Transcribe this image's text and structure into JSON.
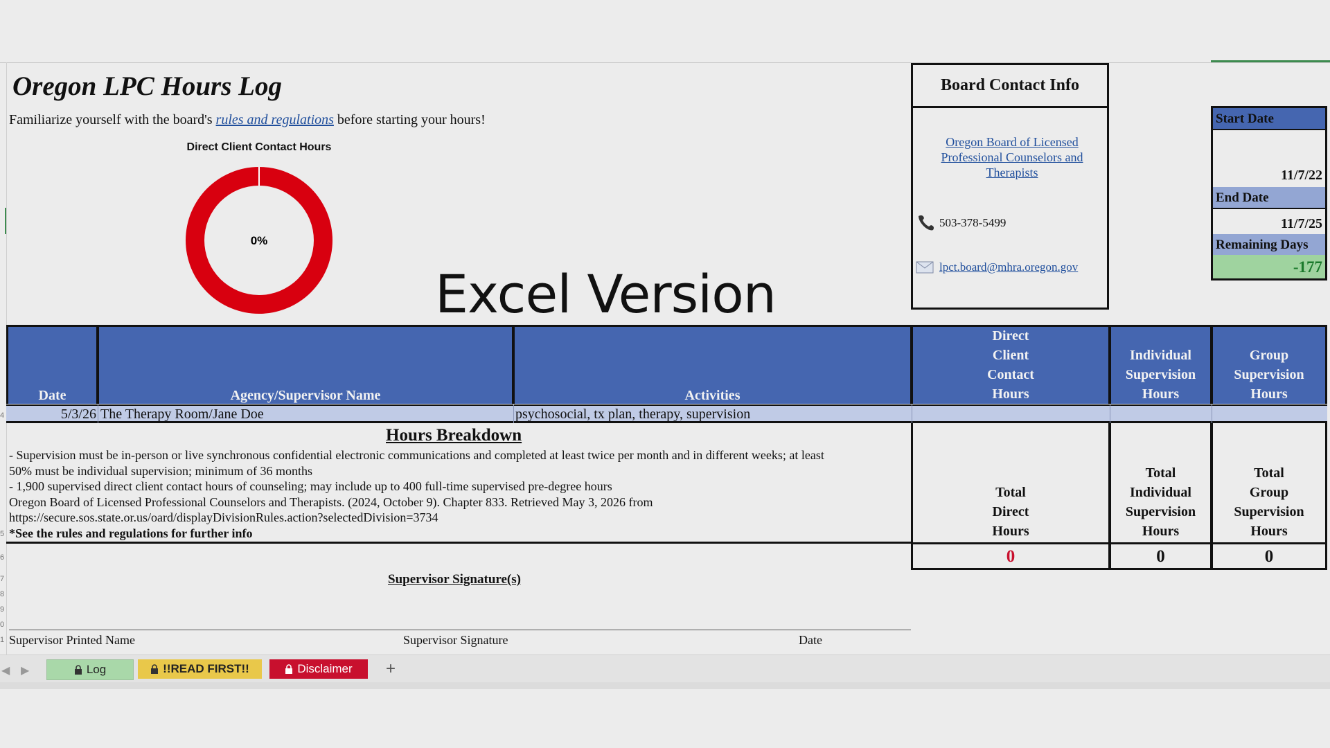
{
  "title": "Oregon LPC Hours Log",
  "intro": {
    "before": "Familiarize yourself with the board's ",
    "link": "rules and regulations",
    "after": " before starting your hours!"
  },
  "chart_data": {
    "type": "pie",
    "title": "Direct Client Contact Hours",
    "center_label": "0%",
    "values": [
      0,
      100
    ],
    "colors": [
      "#d9d9d9",
      "#d8000f"
    ]
  },
  "overlay_text": "Excel Version",
  "contact": {
    "header": "Board Contact Info",
    "org": "Oregon Board of Licensed Professional Counselors and Therapists",
    "phone": "503-378-5499",
    "email": "lpct.board@mhra.oregon.gov"
  },
  "dates": {
    "start_label": "Start Date",
    "start_value": "11/7/22",
    "end_label": "End Date",
    "end_value": "11/7/25",
    "remaining_label": "Remaining Days",
    "remaining_value": "-177"
  },
  "columns": {
    "date": "Date",
    "agency": "Agency/Supervisor Name",
    "activities": "Activities",
    "direct": [
      "Direct",
      "Client",
      "Contact",
      "Hours"
    ],
    "individual": [
      "Individual",
      "Supervision",
      "Hours"
    ],
    "group": [
      "Group",
      "Supervision",
      "Hours"
    ]
  },
  "row": {
    "date": "5/3/26",
    "agency": "The Therapy Room/Jane Doe",
    "activities": "psychosocial, tx plan, therapy, supervision"
  },
  "breakdown": {
    "title": "Hours Breakdown",
    "line1": "- Supervision must be in-person or live synchronous confidential electronic communications and completed at least twice per month and in different weeks; at least",
    "line2": "50% must be individual supervision; minimum of 36 months",
    "line3": "- 1,900 supervised direct client contact hours of counseling; may include up to 400 full-time supervised pre-degree hours",
    "line4": "Oregon Board of Licensed Professional Counselors and Therapists. (2024, October 9). Chapter 833. Retrieved May 3, 2026 from",
    "line5": "https://secure.sos.state.or.us/oard/displayDivisionRules.action?selectedDivision=3734",
    "note": "*See the rules and regulations for further info"
  },
  "totals": {
    "direct_label": [
      "Total",
      "Direct",
      "Hours"
    ],
    "individual_label": [
      "Total",
      "Individual",
      "Supervision",
      "Hours"
    ],
    "group_label": [
      "Total",
      "Group",
      "Supervision",
      "Hours"
    ],
    "direct_value": "0",
    "individual_value": "0",
    "group_value": "0"
  },
  "signature": {
    "title": "Supervisor Signature(s)",
    "printed_name": "Supervisor Printed Name",
    "signature": "Supervisor Signature",
    "date": "Date"
  },
  "tabs": [
    {
      "label": "Log",
      "color": "#a9d8a9"
    },
    {
      "label": "!!READ FIRST!!",
      "color": "#e9c84a"
    },
    {
      "label": "Disclaimer",
      "color": "#c8102e"
    }
  ],
  "add_tab": "+",
  "gutter_numbers": [
    "4",
    "5",
    "6",
    "7",
    "8",
    "9",
    "0",
    "1"
  ]
}
